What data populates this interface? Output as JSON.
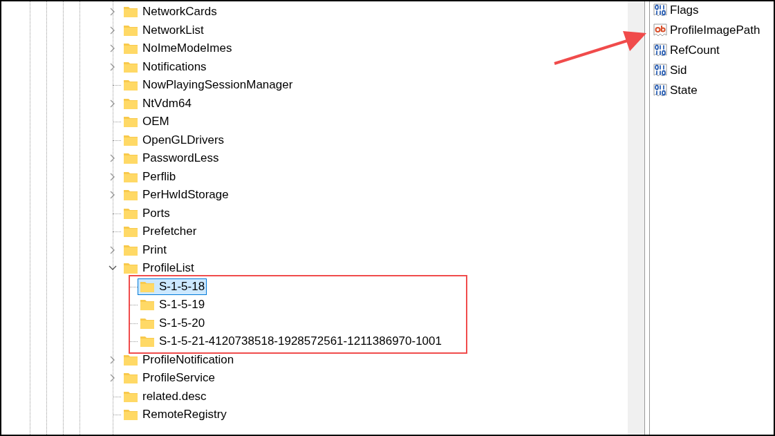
{
  "tree": [
    {
      "label": "NetworkCards",
      "kind": "branch",
      "expanded": false,
      "selected": false
    },
    {
      "label": "NetworkList",
      "kind": "branch",
      "expanded": false,
      "selected": false
    },
    {
      "label": "NoImeModeImes",
      "kind": "branch",
      "expanded": false,
      "selected": false
    },
    {
      "label": "Notifications",
      "kind": "branch",
      "expanded": false,
      "selected": false
    },
    {
      "label": "NowPlayingSessionManager",
      "kind": "leaf",
      "selected": false
    },
    {
      "label": "NtVdm64",
      "kind": "branch",
      "expanded": false,
      "selected": false
    },
    {
      "label": "OEM",
      "kind": "leaf",
      "selected": false
    },
    {
      "label": "OpenGLDrivers",
      "kind": "leaf",
      "selected": false
    },
    {
      "label": "PasswordLess",
      "kind": "branch",
      "expanded": false,
      "selected": false
    },
    {
      "label": "Perflib",
      "kind": "branch",
      "expanded": false,
      "selected": false
    },
    {
      "label": "PerHwIdStorage",
      "kind": "branch",
      "expanded": false,
      "selected": false
    },
    {
      "label": "Ports",
      "kind": "leaf",
      "selected": false
    },
    {
      "label": "Prefetcher",
      "kind": "leaf",
      "selected": false
    },
    {
      "label": "Print",
      "kind": "branch",
      "expanded": false,
      "selected": false
    },
    {
      "label": "ProfileList",
      "kind": "branch",
      "expanded": true,
      "selected": false,
      "children": [
        {
          "label": "S-1-5-18",
          "kind": "leaf",
          "selected": true
        },
        {
          "label": "S-1-5-19",
          "kind": "leaf",
          "selected": false
        },
        {
          "label": "S-1-5-20",
          "kind": "leaf",
          "selected": false
        },
        {
          "label": "S-1-5-21-4120738518-1928572561-1211386970-1001",
          "kind": "leaf",
          "selected": false
        }
      ]
    },
    {
      "label": "ProfileNotification",
      "kind": "branch",
      "expanded": false,
      "selected": false
    },
    {
      "label": "ProfileService",
      "kind": "branch",
      "expanded": false,
      "selected": false
    },
    {
      "label": "related.desc",
      "kind": "leaf",
      "selected": false
    },
    {
      "label": "RemoteRegistry",
      "kind": "leaf",
      "selected": false
    }
  ],
  "values": [
    {
      "name": "Flags",
      "kind": "dword"
    },
    {
      "name": "ProfileImagePath",
      "kind": "string"
    },
    {
      "name": "RefCount",
      "kind": "dword"
    },
    {
      "name": "Sid",
      "kind": "dword"
    },
    {
      "name": "State",
      "kind": "dword"
    }
  ]
}
